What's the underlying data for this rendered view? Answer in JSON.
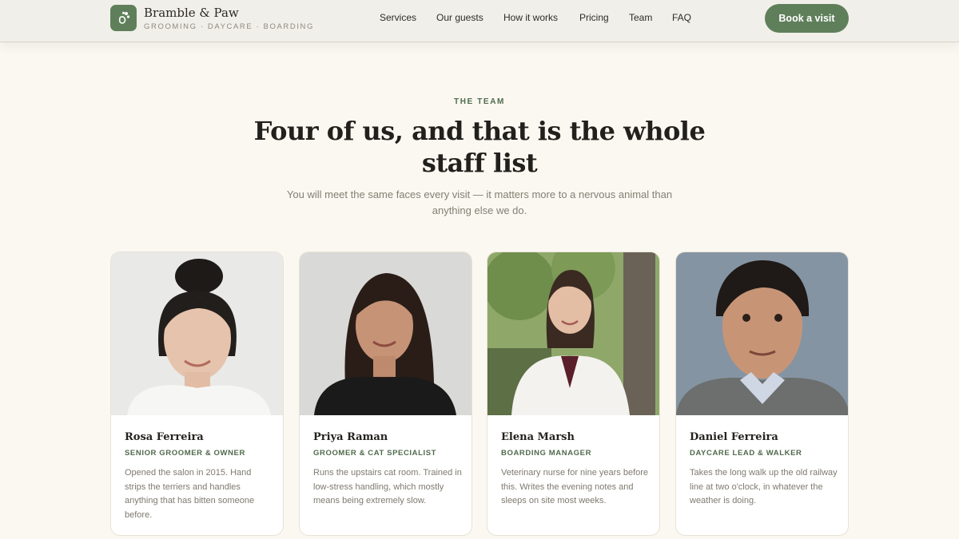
{
  "brand": {
    "name": "Bramble & Paw",
    "tagline": "GROOMING · DAYCARE · BOARDING",
    "icon": "paw-icon",
    "accent": "#5f7f5b"
  },
  "nav": {
    "items": [
      "Services",
      "Our guests",
      "How it works",
      "Pricing",
      "Team",
      "FAQ"
    ],
    "cta": "Book a visit"
  },
  "intro": {
    "eyebrow": "THE TEAM",
    "headline": "Four of us, and that is the whole staff list",
    "lede": "You will meet the same faces every visit — it matters more to a nervous animal than anything else we do."
  },
  "team": [
    {
      "name": "Rosa Ferreira",
      "role": "SENIOR GROOMER & OWNER",
      "bio": "Opened the salon in 2015. Hand strips the terriers and handles anything that has bitten someone before.",
      "photo": "portrait-photo"
    },
    {
      "name": "Priya Raman",
      "role": "GROOMER & CAT SPECIALIST",
      "bio": "Runs the upstairs cat room. Trained in low-stress handling, which mostly means being extremely slow.",
      "photo": "portrait-photo"
    },
    {
      "name": "Elena Marsh",
      "role": "BOARDING MANAGER",
      "bio": "Veterinary nurse for nine years before this. Writes the evening notes and sleeps on site most weeks.",
      "photo": "portrait-photo"
    },
    {
      "name": "Daniel Ferreira",
      "role": "DAYCARE LEAD & WALKER",
      "bio": "Takes the long walk up the old railway line at two o'clock, in whatever the weather is doing.",
      "photo": "portrait-photo"
    }
  ]
}
